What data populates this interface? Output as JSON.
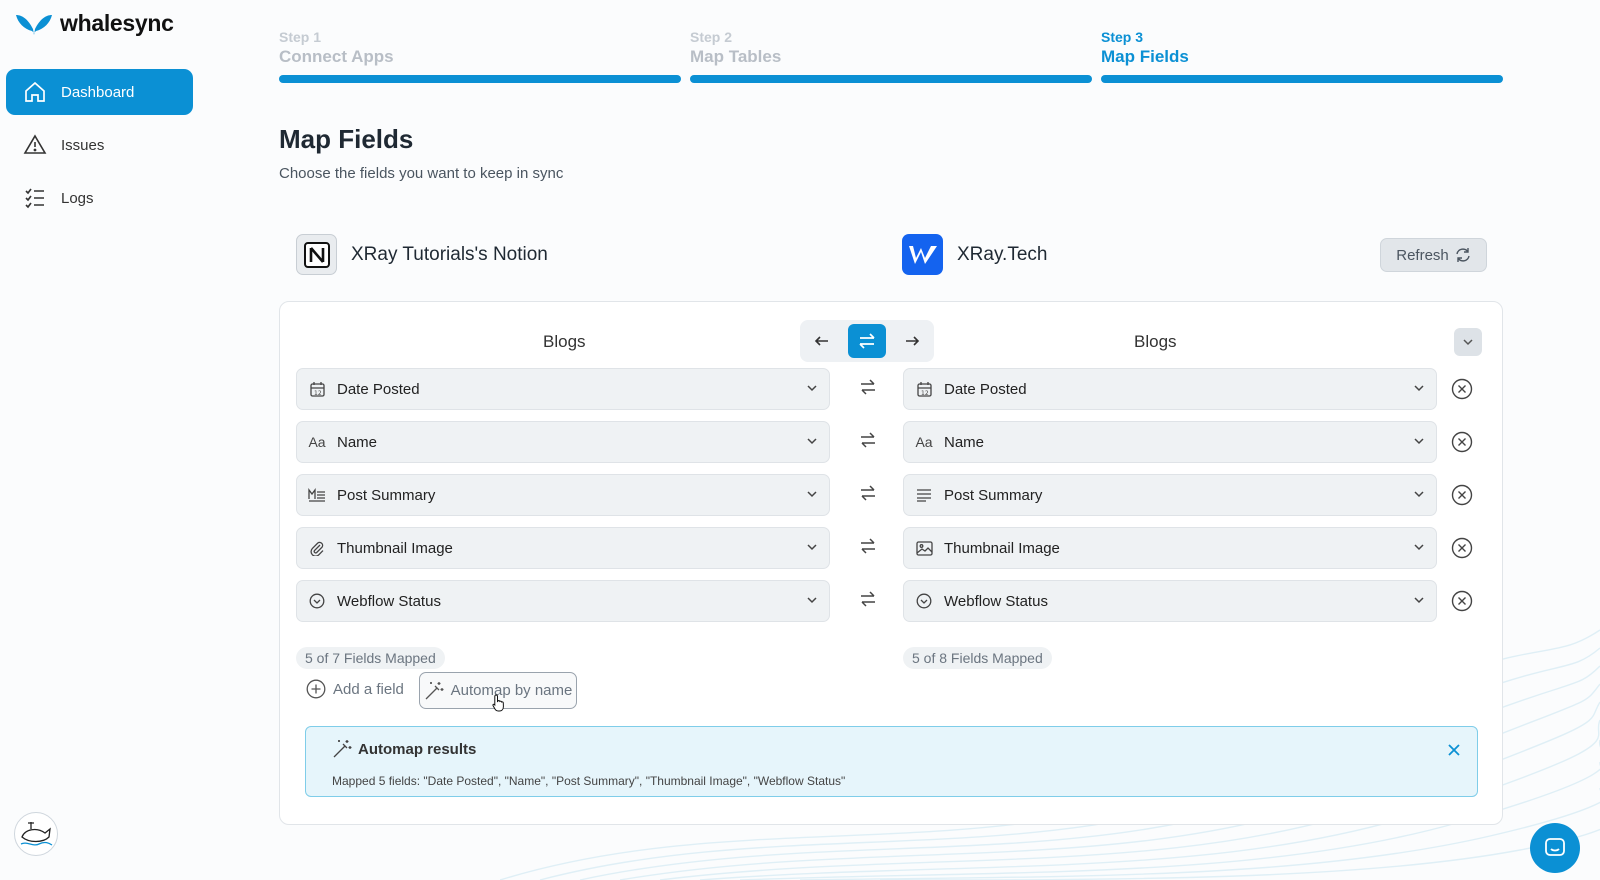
{
  "brand": {
    "name": "whalesync"
  },
  "sidebar": {
    "items": [
      {
        "label": "Dashboard",
        "icon": "home-icon",
        "active": true
      },
      {
        "label": "Issues",
        "icon": "warning-icon",
        "active": false
      },
      {
        "label": "Logs",
        "icon": "list-check-icon",
        "active": false
      }
    ]
  },
  "steps": [
    {
      "num": "Step 1",
      "label": "Connect Apps"
    },
    {
      "num": "Step 2",
      "label": "Map Tables"
    },
    {
      "num": "Step 3",
      "label": "Map Fields"
    }
  ],
  "header": {
    "title": "Map Fields",
    "subtitle": "Choose the fields you want to keep in sync"
  },
  "apps": {
    "left": {
      "name": "XRay Tutorials's Notion",
      "icon": "notion-icon"
    },
    "right": {
      "name": "XRay.Tech",
      "icon": "webflow-icon"
    },
    "refresh_label": "Refresh"
  },
  "mapping": {
    "left_table": "Blogs",
    "right_table": "Blogs",
    "rows": [
      {
        "left": {
          "label": "Date Posted",
          "icon": "calendar-icon"
        },
        "right": {
          "label": "Date Posted",
          "icon": "calendar-icon"
        }
      },
      {
        "left": {
          "label": "Name",
          "icon": "text-icon"
        },
        "right": {
          "label": "Name",
          "icon": "text-icon"
        }
      },
      {
        "left": {
          "label": "Post Summary",
          "icon": "markdown-icon"
        },
        "right": {
          "label": "Post Summary",
          "icon": "paragraph-icon"
        }
      },
      {
        "left": {
          "label": "Thumbnail Image",
          "icon": "paperclip-icon"
        },
        "right": {
          "label": "Thumbnail Image",
          "icon": "image-icon"
        }
      },
      {
        "left": {
          "label": "Webflow Status",
          "icon": "status-icon"
        },
        "right": {
          "label": "Webflow Status",
          "icon": "status-icon"
        }
      }
    ],
    "left_count": "5 of 7 Fields Mapped",
    "right_count": "5 of 8 Fields Mapped",
    "add_field_label": "Add a field",
    "automap_label": "Automap by name"
  },
  "automap_results": {
    "title": "Automap results",
    "message": "Mapped 5 fields: \"Date Posted\", \"Name\", \"Post Summary\", \"Thumbnail Image\", \"Webflow Status\""
  },
  "colors": {
    "accent": "#0b90d4",
    "results_bg": "#e6f5fb",
    "results_border": "#7fcde9"
  }
}
